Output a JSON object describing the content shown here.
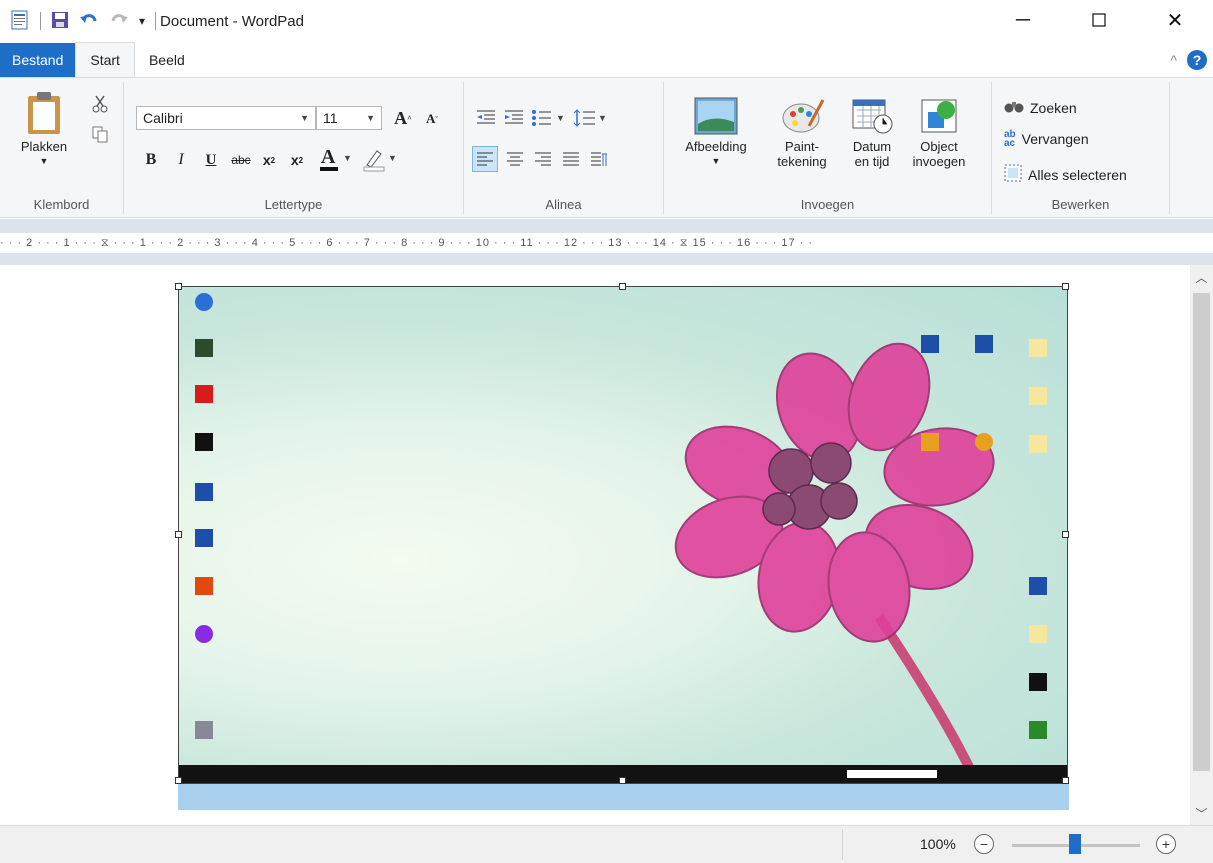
{
  "window": {
    "title": "Document - WordPad",
    "controls": [
      "minimize",
      "maximize",
      "close"
    ]
  },
  "quick_access": {
    "icons": [
      "wordpad-icon",
      "save-icon",
      "undo-icon",
      "redo-icon",
      "customize-icon"
    ]
  },
  "tabs": [
    {
      "label": "Bestand"
    },
    {
      "label": "Start"
    },
    {
      "label": "Beeld"
    }
  ],
  "ribbon": {
    "klembord": {
      "label": "Klembord",
      "paste": "Plakken"
    },
    "lettertype": {
      "label": "Lettertype",
      "font": "Calibri",
      "size": "11"
    },
    "alinea": {
      "label": "Alinea"
    },
    "invoegen": {
      "label": "Invoegen",
      "picture": "Afbeelding",
      "paint_line1": "Paint-",
      "paint_line2": "tekening",
      "date_line1": "Datum",
      "date_line2": "en tijd",
      "object_line1": "Object",
      "object_line2": "invoegen"
    },
    "bewerken": {
      "label": "Bewerken",
      "find": "Zoeken",
      "replace": "Vervangen",
      "select_all": "Alles selecteren"
    }
  },
  "ruler": {
    "text": "· · · 2 · · · 1 · · · ⧖ · · · 1 · · · 2 · · · 3 · · · 4 · · · 5 · · · 6 · · · 7 · · · 8 · · · 9 · · · 10 · · · 11 · · · 12 · · · 13 · · · 14 · ⧖ 15 · · · 16 · · · 17 · ·"
  },
  "statusbar": {
    "zoom": "100%",
    "zoom_level": 1.0
  },
  "colors": {
    "accent": "#1e6ec8",
    "ribbon_bg": "#f5f6f7",
    "ruler_bg": "#dde3ec",
    "flower": "#e0409a"
  }
}
